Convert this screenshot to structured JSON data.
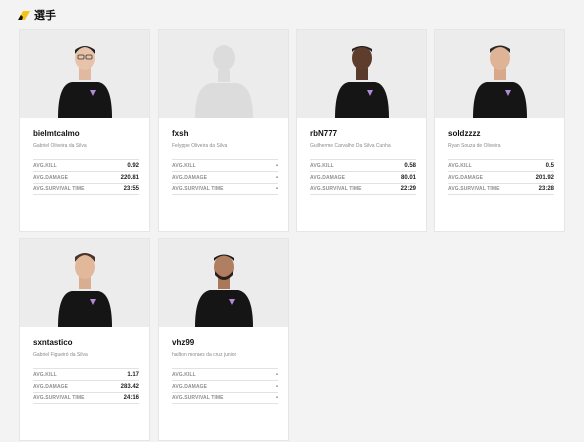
{
  "section": {
    "title": "選手"
  },
  "colors": {
    "accent": "#f2c418",
    "background": "#f3f3f3",
    "card": "#ffffff"
  },
  "stat_labels": {
    "kill": "AVG.KILL",
    "damage": "AVG.DAMAGE",
    "survival": "AVG.SURVIVAL TIME"
  },
  "players": [
    {
      "nick": "bielmtcalmo",
      "name": "Gabriel Oliveira da Silva",
      "has_photo": true,
      "kill": "0.92",
      "damage": "220.81",
      "survival": "23:55"
    },
    {
      "nick": "fxsh",
      "name": "Felyppe Oliveira da Silva",
      "has_photo": false,
      "kill": "-",
      "damage": "-",
      "survival": "-"
    },
    {
      "nick": "rbN777",
      "name": "Guilherme Carvalho Da Silva Cunha",
      "has_photo": true,
      "kill": "0.58",
      "damage": "80.01",
      "survival": "22:29"
    },
    {
      "nick": "soldzzzz",
      "name": "Ryan Souza de Oliveira",
      "has_photo": true,
      "kill": "0.5",
      "damage": "201.92",
      "survival": "23:28"
    },
    {
      "nick": "sxntastico",
      "name": "Gabriel Figueiró da Silva",
      "has_photo": true,
      "kill": "1.17",
      "damage": "283.42",
      "survival": "24:16"
    },
    {
      "nick": "vhz99",
      "name": "hailton moraes da cruz junior",
      "has_photo": true,
      "kill": "-",
      "damage": "-",
      "survival": "-"
    }
  ]
}
